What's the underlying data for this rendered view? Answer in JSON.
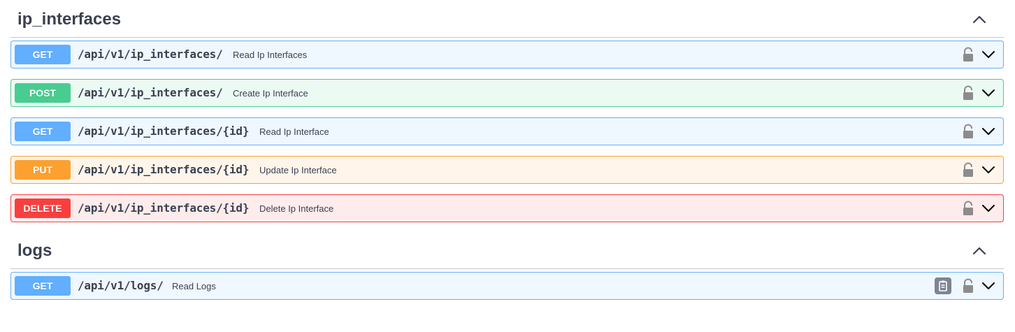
{
  "sections": [
    {
      "title": "ip_interfaces",
      "operations": [
        {
          "method": "GET",
          "path": "/api/v1/ip_interfaces/",
          "summary": "Read Ip Interfaces"
        },
        {
          "method": "POST",
          "path": "/api/v1/ip_interfaces/",
          "summary": "Create Ip Interface"
        },
        {
          "method": "GET",
          "path": "/api/v1/ip_interfaces/{id}",
          "summary": "Read Ip Interface"
        },
        {
          "method": "PUT",
          "path": "/api/v1/ip_interfaces/{id}",
          "summary": "Update Ip Interface"
        },
        {
          "method": "DELETE",
          "path": "/api/v1/ip_interfaces/{id}",
          "summary": "Delete Ip Interface"
        }
      ]
    },
    {
      "title": "logs",
      "operations": [
        {
          "method": "GET",
          "path": "/api/v1/logs/",
          "summary": "Read Logs"
        }
      ]
    }
  ],
  "icons": {
    "collapse": "chevron-up-icon",
    "expand": "chevron-down-icon",
    "lock": "lock-icon",
    "copy": "copy-to-clipboard-icon"
  },
  "colors": {
    "get": "#61affe",
    "post": "#49cc90",
    "put": "#fca130",
    "delete": "#f93e3e"
  }
}
